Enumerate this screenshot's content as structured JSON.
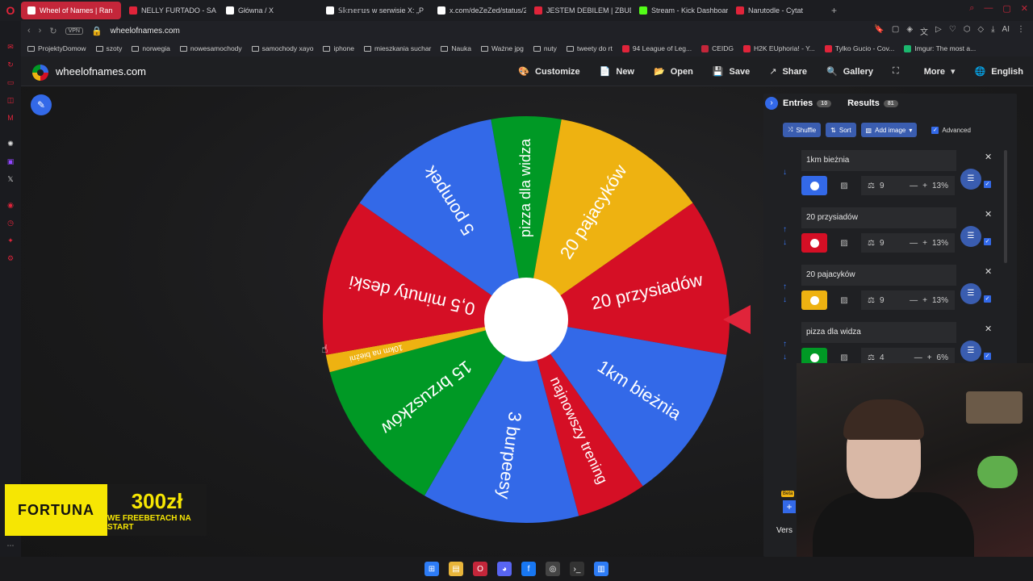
{
  "browser": {
    "tabs": [
      {
        "label": "Wheel of Names | Ran",
        "color": "#ffffff",
        "active": true
      },
      {
        "label": "NELLY FURTADO - SA",
        "color": "#e0243a"
      },
      {
        "label": "Główna / X",
        "color": "#ffffff"
      },
      {
        "label": "𝕊𝕜𝕟𝕖𝕣𝕦𝕤 w serwisie X: „P",
        "color": "#ffffff"
      },
      {
        "label": "x.com/deZeZed/status/20",
        "color": "#ffffff"
      },
      {
        "label": "JESTEM DEBILEM | ZBUD",
        "color": "#e0243a"
      },
      {
        "label": "Stream - Kick Dashboard",
        "color": "#53fc18"
      },
      {
        "label": "Narutodle - Cytat",
        "color": "#e0243a"
      }
    ],
    "vpn_label": "VPN",
    "url": "wheelofnames.com",
    "ai_label": "AI",
    "bookmarks": [
      {
        "label": "ProjektyDomow",
        "type": "folder"
      },
      {
        "label": "szoty",
        "type": "folder"
      },
      {
        "label": "norwegia",
        "type": "folder"
      },
      {
        "label": "nowesamochody",
        "type": "folder"
      },
      {
        "label": "samochody xayo",
        "type": "folder"
      },
      {
        "label": "iphone",
        "type": "folder"
      },
      {
        "label": "mieszkania suchar",
        "type": "folder"
      },
      {
        "label": "Nauka",
        "type": "folder"
      },
      {
        "label": "Ważne jpg",
        "type": "folder"
      },
      {
        "label": "nuty",
        "type": "folder"
      },
      {
        "label": "tweety do rt",
        "type": "folder"
      },
      {
        "label": "94 League of Leg...",
        "type": "site",
        "color": "#e0243a"
      },
      {
        "label": "CEIDG",
        "type": "site",
        "color": "#c4263a"
      },
      {
        "label": "H2K EUphoria! - Y...",
        "type": "site",
        "color": "#e0243a"
      },
      {
        "label": "Tylko Gucio - Cov...",
        "type": "site",
        "color": "#e0243a"
      },
      {
        "label": "Imgur: The most a...",
        "type": "site",
        "color": "#1bb76e"
      }
    ]
  },
  "site": {
    "name": "wheelofnames.com",
    "nav": [
      {
        "label": "Customize",
        "icon": "palette-icon",
        "glyph": "🎨"
      },
      {
        "label": "New",
        "icon": "new-file-icon",
        "glyph": "📄"
      },
      {
        "label": "Open",
        "icon": "folder-open-icon",
        "glyph": "📂"
      },
      {
        "label": "Save",
        "icon": "save-icon",
        "glyph": "💾"
      },
      {
        "label": "Share",
        "icon": "share-icon",
        "glyph": "↗"
      },
      {
        "label": "Gallery",
        "icon": "search-icon",
        "glyph": "🔍"
      },
      {
        "label": "",
        "icon": "fullscreen-icon",
        "glyph": "⛶"
      },
      {
        "label": "More",
        "icon": "chevron-down-icon",
        "glyph": "▾"
      },
      {
        "label": "English",
        "icon": "globe-icon",
        "glyph": "🌐"
      }
    ]
  },
  "wheel": {
    "segments": [
      {
        "label": "pizza dla widza",
        "color": "#009925",
        "weight": 4
      },
      {
        "label": "20 pajacyków",
        "color": "#eeb211",
        "weight": 9
      },
      {
        "label": "20 przysiadów",
        "color": "#d50f25",
        "weight": 9
      },
      {
        "label": "1km bieżnia",
        "color": "#3369e8",
        "weight": 9
      },
      {
        "label": "najnowszy trening",
        "color": "#d50f25",
        "weight": 4
      },
      {
        "label": "3 burpeesy",
        "color": "#3369e8",
        "weight": 9
      },
      {
        "label": "15 brzuszków",
        "color": "#009925",
        "weight": 9
      },
      {
        "label": "10km na bieżni",
        "color": "#eeb211",
        "weight": 1
      },
      {
        "label": "0,5 minuty deski",
        "color": "#d50f25",
        "weight": 9
      },
      {
        "label": "5 pompek",
        "color": "#3369e8",
        "weight": 9
      }
    ]
  },
  "panel": {
    "tabs": [
      {
        "label": "Entries",
        "count": "10"
      },
      {
        "label": "Results",
        "count": "81"
      }
    ],
    "actions": {
      "shuffle": "Shuffle",
      "sort": "Sort",
      "add_image": "Add image",
      "advanced": "Advanced"
    },
    "entries": [
      {
        "text": "1km bieżnia",
        "color": "#3369e8",
        "weight": "9",
        "percent": "13%"
      },
      {
        "text": "20 przysiadów",
        "color": "#d50f25",
        "weight": "9",
        "percent": "13%"
      },
      {
        "text": "20 pajacyków",
        "color": "#eeb211",
        "weight": "9",
        "percent": "13%"
      },
      {
        "text": "pizza dla widza",
        "color": "#009925",
        "weight": "4",
        "percent": "6%"
      }
    ]
  },
  "overlay": {
    "fortuna_brand": "FORTUNA",
    "fortuna_amount": "300zł",
    "fortuna_text": "WE FREEBETACH NA START",
    "version_label": "Vers",
    "beta_label": "Beta"
  }
}
